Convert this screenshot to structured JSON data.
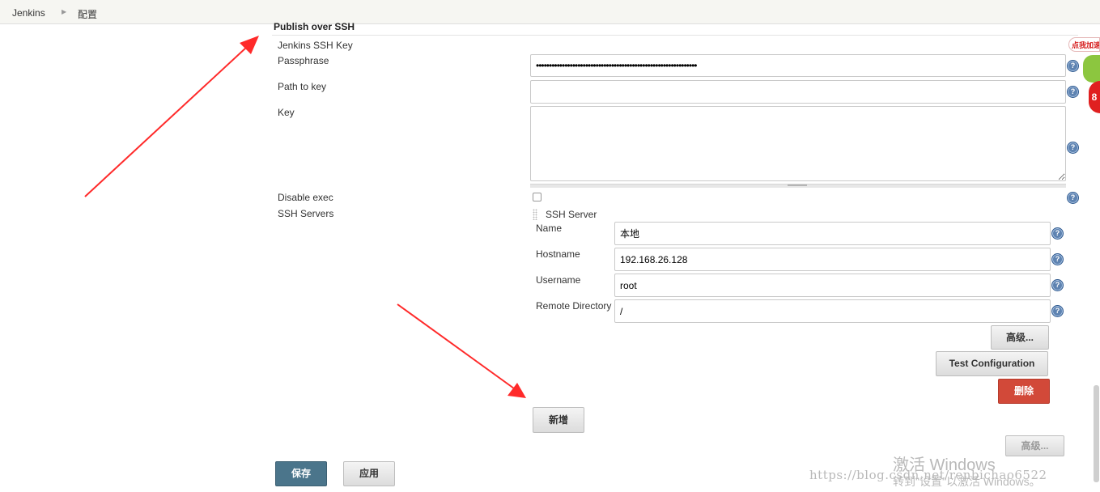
{
  "breadcrumb": {
    "items": [
      "Jenkins",
      "配置"
    ]
  },
  "section": {
    "title": "Publish over SSH"
  },
  "ssh_key": {
    "label": "Jenkins SSH Key",
    "passphrase_label": "Passphrase",
    "passphrase_value": "••••••••••••••••••••••••••••••••••••••••••••••••••••••••••••••",
    "path_label": "Path to key",
    "path_value": "",
    "key_label": "Key",
    "key_value": "",
    "disable_exec_label": "Disable exec",
    "disable_exec_checked": false
  },
  "ssh_servers": {
    "label": "SSH Servers",
    "server_header": "SSH Server",
    "name_label": "Name",
    "name_value": "本地",
    "hostname_label": "Hostname",
    "hostname_value": "192.168.26.128",
    "username_label": "Username",
    "username_value": "root",
    "remote_dir_label": "Remote Directory",
    "remote_dir_value": "/",
    "advanced_button": "高级...",
    "test_button": "Test Configuration",
    "delete_button": "删除",
    "add_button": "新增",
    "section_advanced_button": "高级..."
  },
  "footer": {
    "save_button": "保存",
    "apply_button": "应用"
  },
  "help_icon_text": "?",
  "overlay": {
    "badge_text": "点我加速",
    "badge_number": "8",
    "windows_line1": "激活 Windows",
    "windows_line2": "转到\"设置\"以激活 Windows。",
    "blog_url": "https://blog.csdn.net/renbichao6522"
  },
  "colors": {
    "accent_blue": "#4b758b",
    "danger_red": "#d24939",
    "arrow_red": "#ff2a2a"
  }
}
